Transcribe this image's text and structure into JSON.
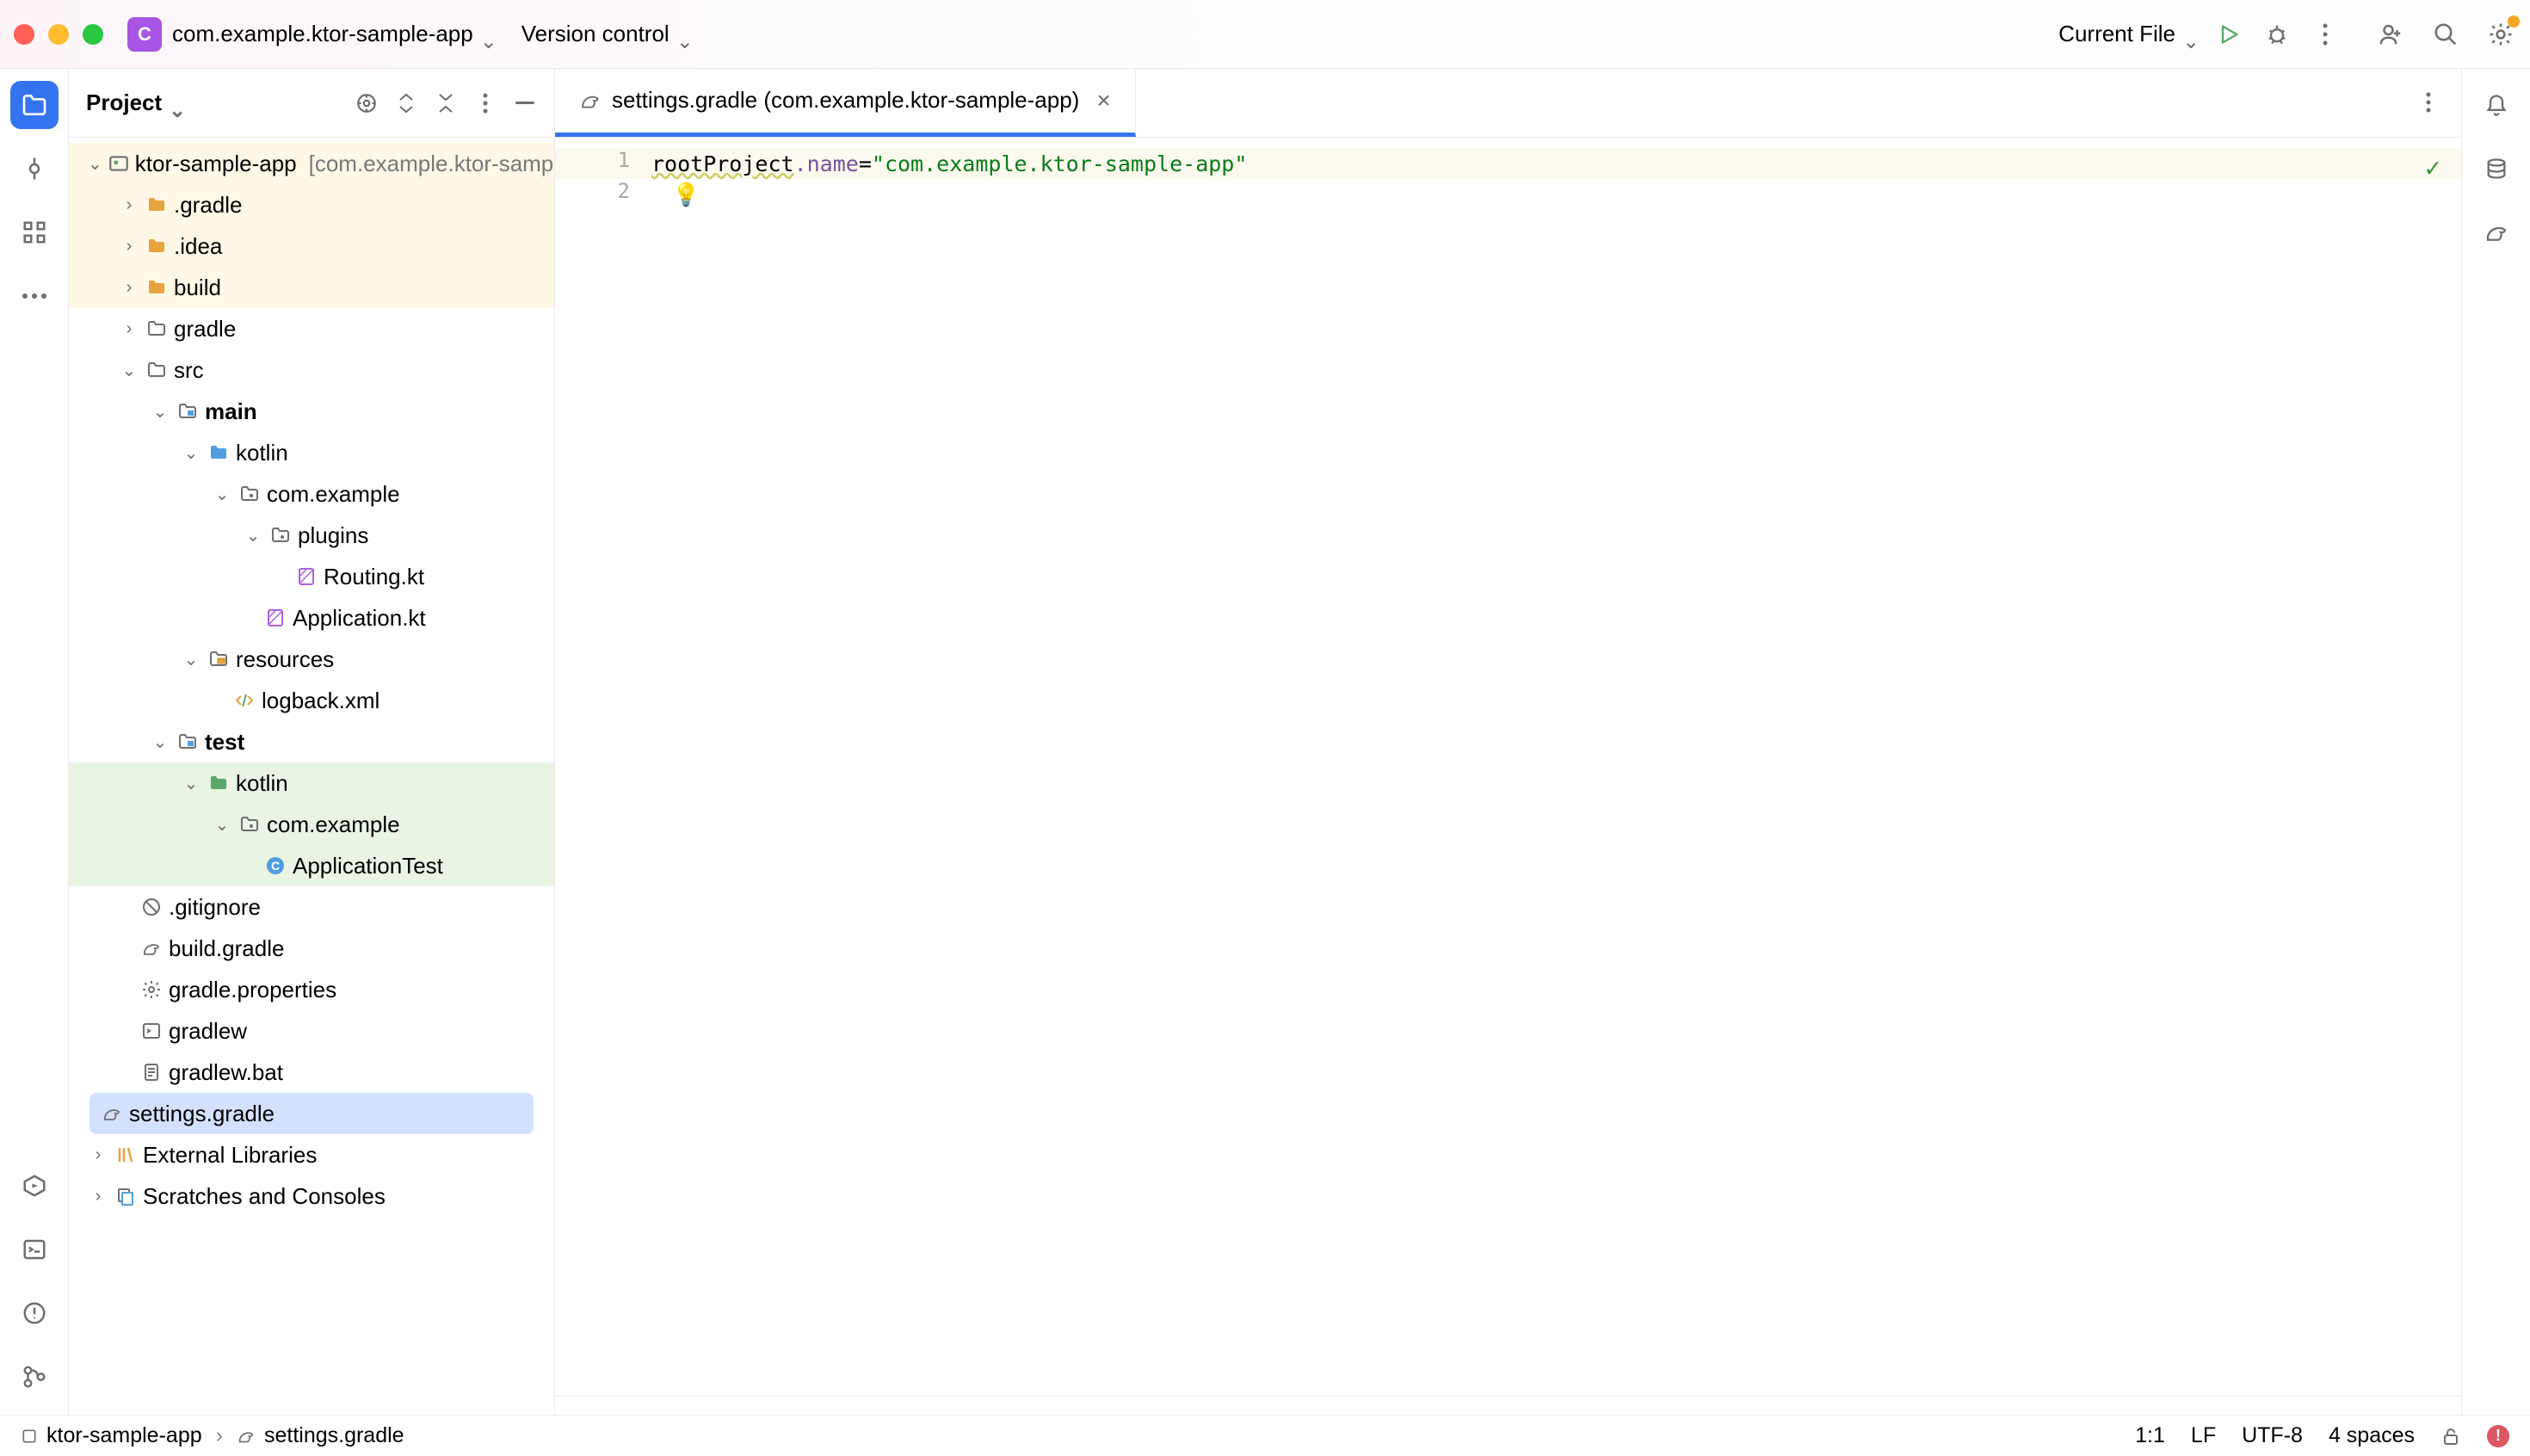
{
  "titlebar": {
    "project_badge": "C",
    "project_name": "com.example.ktor-sample-app",
    "version_control": "Version control"
  },
  "run": {
    "config_label": "Current File"
  },
  "project_panel": {
    "title": "Project"
  },
  "tree": {
    "root": {
      "name": "ktor-sample-app",
      "hint": "[com.example.ktor-sample-app]"
    },
    "nodes": [
      {
        "name": ".gradle"
      },
      {
        "name": ".idea"
      },
      {
        "name": "build"
      },
      {
        "name": "gradle"
      },
      {
        "name": "src"
      },
      {
        "name": "main"
      },
      {
        "name": "kotlin"
      },
      {
        "name": "com.example"
      },
      {
        "name": "plugins"
      },
      {
        "name": "Routing.kt"
      },
      {
        "name": "Application.kt"
      },
      {
        "name": "resources"
      },
      {
        "name": "logback.xml"
      },
      {
        "name": "test"
      },
      {
        "name": "kotlin"
      },
      {
        "name": "com.example"
      },
      {
        "name": "ApplicationTest"
      },
      {
        "name": ".gitignore"
      },
      {
        "name": "build.gradle"
      },
      {
        "name": "gradle.properties"
      },
      {
        "name": "gradlew"
      },
      {
        "name": "gradlew.bat"
      },
      {
        "name": "settings.gradle"
      },
      {
        "name": "External Libraries"
      },
      {
        "name": "Scratches and Consoles"
      }
    ]
  },
  "editor": {
    "tab_label": "settings.gradle (com.example.ktor-sample-app)",
    "lines": {
      "n1": "1",
      "n2": "2",
      "ident": "rootProject",
      "prop": ".name",
      "eq": " = ",
      "str": "\"com.example.ktor-sample-app\""
    }
  },
  "breadcrumb": {
    "root": "ktor-sample-app",
    "file": "settings.gradle"
  },
  "status": {
    "caret": "1:1",
    "line_sep": "LF",
    "encoding": "UTF-8",
    "indent": "4 spaces"
  },
  "icons": {
    "project": "project-icon",
    "search": "search-icon",
    "settings": "gear-icon"
  }
}
